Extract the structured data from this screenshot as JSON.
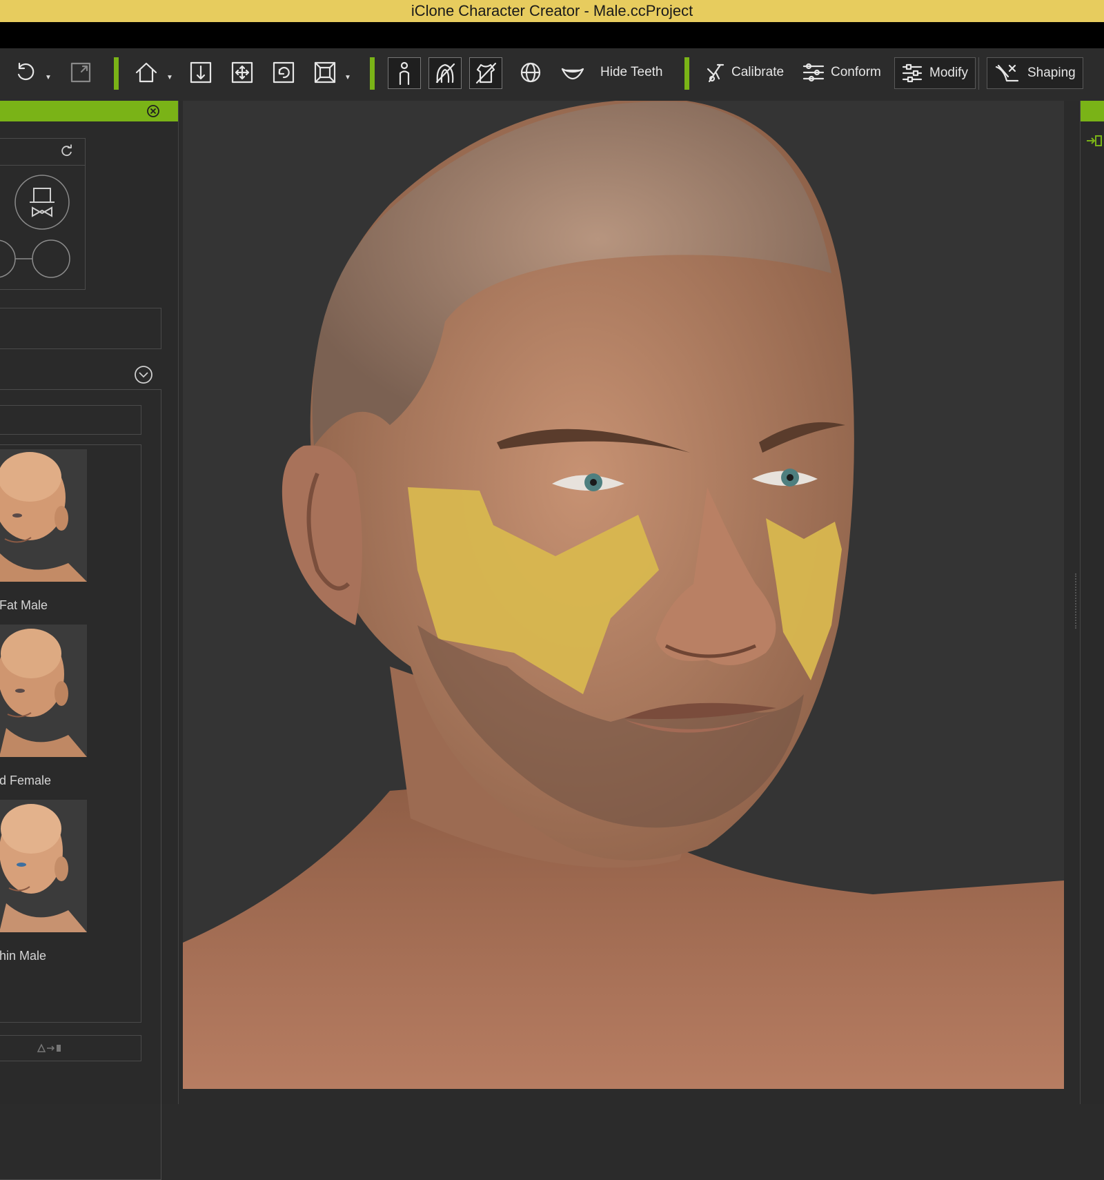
{
  "window": {
    "title": "iClone Character Creator - Male.ccProject"
  },
  "toolbar": {
    "hide_teeth_label": "Hide Teeth",
    "calibrate_label": "Calibrate",
    "conform_label": "Conform",
    "modify_label": "Modify",
    "shaping_label": "Shaping"
  },
  "presets": [
    {
      "label": "Fat Male"
    },
    {
      "label": "d Female"
    },
    {
      "label": "hin Male"
    }
  ],
  "colors": {
    "accent": "#7ab317",
    "titlebar": "#e7cc5e",
    "highlight_mask": "#d8b74f"
  }
}
